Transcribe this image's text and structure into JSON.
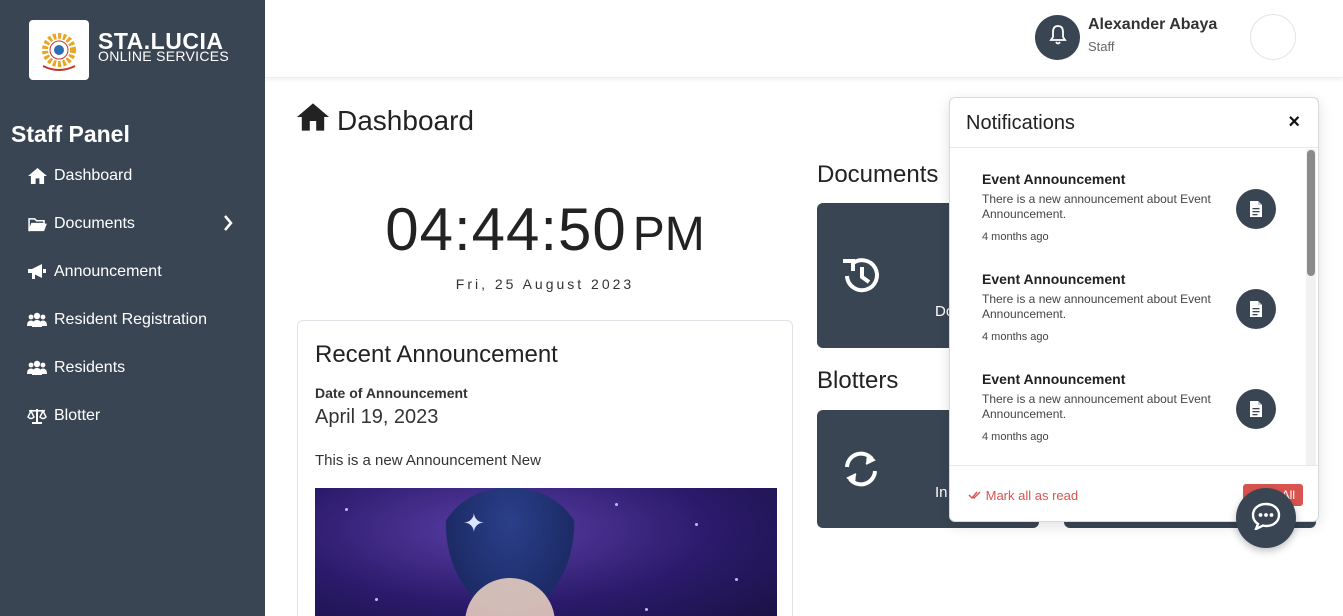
{
  "brand": {
    "title": "STA.LUCIA",
    "subtitle": "ONLINE SERVICES"
  },
  "sidebar": {
    "panel_title": "Staff Panel",
    "items": [
      {
        "label": "Dashboard",
        "icon": "home-icon"
      },
      {
        "label": "Documents",
        "icon": "folder-open-icon"
      },
      {
        "label": "Announcement",
        "icon": "bullhorn-icon"
      },
      {
        "label": "Resident Registration",
        "icon": "users-icon"
      },
      {
        "label": "Residents",
        "icon": "users-icon"
      },
      {
        "label": "Blotter",
        "icon": "scale-icon"
      }
    ]
  },
  "header": {
    "user_name": "Alexander Abaya",
    "user_role": "Staff"
  },
  "main": {
    "page_title": "Dashboard",
    "clock_time": "04:44:50",
    "clock_ampm": "PM",
    "date": "Fri, 25 August 2023",
    "announcement": {
      "title": "Recent Announcement",
      "date_label": "Date of Announcement",
      "date": "April 19, 2023",
      "text": "This is a new Announcement New"
    },
    "documents_title": "Documents",
    "documents_card_label": "Do",
    "blotters_title": "Blotters",
    "blotters_card_label": "In"
  },
  "notifications": {
    "title": "Notifications",
    "close": "×",
    "items": [
      {
        "title": "Event Announcement",
        "text": "There is a new announcement about Event Announcement.",
        "time": "4 months ago"
      },
      {
        "title": "Event Announcement",
        "text": "There is a new announcement about Event Announcement.",
        "time": "4 months ago"
      },
      {
        "title": "Event Announcement",
        "text": "There is a new announcement about Event Announcement.",
        "time": "4 months ago"
      }
    ],
    "mark_all_read": "Mark all as read",
    "delete_all": "All"
  },
  "colors": {
    "sidebar_bg": "#3a4554",
    "accent_red": "#d9534f",
    "card_dark": "#3a4554"
  }
}
